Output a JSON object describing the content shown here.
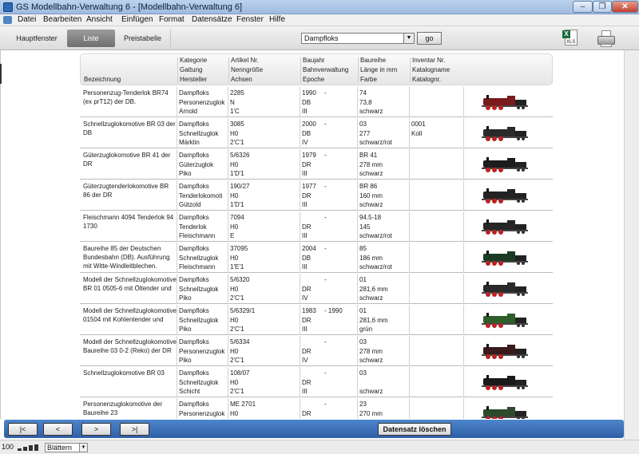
{
  "window": {
    "title": "GS Modellbahn-Verwaltung 6 - [Modellbahn-Verwaltung 6]",
    "minimize": "–",
    "maximize": "❐",
    "close": "✕"
  },
  "menu": [
    "Datei",
    "Bearbeiten",
    "Ansicht",
    "Einfügen",
    "Format",
    "Datensätze",
    "Fenster",
    "Hilfe"
  ],
  "toolbar": {
    "tabs": [
      "Hauptfenster",
      "Liste",
      "Preistabelle"
    ],
    "filter_value": "Dampfloks",
    "go_label": "go",
    "xls_label": "XLS"
  },
  "header": {
    "bezeichnung": "Bezeichnung",
    "col2": [
      "Kategorie",
      "Gattung",
      "Hersteller"
    ],
    "col3": [
      "Artikel Nr.",
      "Nenngröße",
      "Achsen"
    ],
    "col4": [
      "Baujahr",
      "Bahnverwaltung",
      "Epoche"
    ],
    "col5": [
      "Baureihe",
      "Länge in mm",
      "Farbe"
    ],
    "col6": [
      "Inventar Nr.",
      "Katalogname",
      "Katalognr."
    ]
  },
  "rows": [
    {
      "desc": "Personenzug-Tenderlok BR74 (ex prT12) der DB.",
      "c2": [
        "Dampfloks",
        "Personenzuglok",
        "Arnold"
      ],
      "c3": [
        "2285",
        "N",
        "1'C"
      ],
      "c4": [
        "1990",
        "DB",
        "III"
      ],
      "dash": "-",
      "c5": [
        "74",
        "73,8",
        "schwarz"
      ],
      "c6": [
        "",
        "",
        ""
      ],
      "img_tone": "#7a1b1b"
    },
    {
      "desc": "Schnellzuglokomotive BR 03 der DB",
      "c2": [
        "Dampfloks",
        "Schnellzuglok",
        "Märklin"
      ],
      "c3": [
        "3085",
        "H0",
        "2'C'1"
      ],
      "c4": [
        "2000",
        "DB",
        "IV"
      ],
      "dash": "-",
      "c5": [
        "03",
        "277",
        "schwarz/rot"
      ],
      "c6": [
        "0001",
        "Koll",
        ""
      ],
      "img_tone": "#2a2a2a"
    },
    {
      "desc": "Güterzuglokomotive BR 41 der DR",
      "c2": [
        "Dampfloks",
        "Güterzuglok",
        "Piko"
      ],
      "c3": [
        "5/6326",
        "H0",
        "1'D'1"
      ],
      "c4": [
        "1979",
        "DR",
        "III"
      ],
      "dash": "-",
      "c5": [
        "BR 41",
        "278 mm",
        "schwarz"
      ],
      "c6": [
        "",
        "",
        ""
      ],
      "img_tone": "#1c1c1c"
    },
    {
      "desc": "Güterzugtenderlokomotive BR 86 der DR",
      "c2": [
        "Dampfloks",
        "Tenderlokomoti",
        "Gützold"
      ],
      "c3": [
        "190/27",
        "H0",
        "1'D'1"
      ],
      "c4": [
        "1977",
        "DR",
        "III"
      ],
      "dash": "-",
      "c5": [
        "BR 86",
        "160 mm",
        "schwarz"
      ],
      "c6": [
        "",
        "",
        ""
      ],
      "img_tone": "#222222"
    },
    {
      "desc": "Fleischmann 4094 Tenderlok 94 1730",
      "c2": [
        "Dampfloks",
        "Tenderlok",
        "Fleischmann"
      ],
      "c3": [
        "7094",
        "H0",
        "E"
      ],
      "c4": [
        "",
        "DR",
        "III"
      ],
      "dash": "-",
      "c5": [
        "94.5-18",
        "145",
        "schwarz/rot"
      ],
      "c6": [
        "",
        "",
        ""
      ],
      "img_tone": "#262626"
    },
    {
      "desc": "Baureihe 85 der Deutschen Bundesbahn (DB). Ausführung mit Witte-Windleitblechen.",
      "c2": [
        "Dampfloks",
        "Schnellzuglok",
        "Fleischmann"
      ],
      "c3": [
        "37095",
        "H0",
        "1'E'1"
      ],
      "c4": [
        "2004",
        "DB",
        "III"
      ],
      "dash": "-",
      "c5": [
        "85",
        "186 mm",
        "schwarz/rot"
      ],
      "c6": [
        "",
        "",
        ""
      ],
      "img_tone": "#1d3a22"
    },
    {
      "desc": "Modell der Schnellzuglokomotive BR 01 0505-6 mit Öltender und",
      "c2": [
        "Dampfloks",
        "Schnellzuglok",
        "Piko"
      ],
      "c3": [
        "5/6320",
        "H0",
        "2'C'1"
      ],
      "c4": [
        "",
        "DR",
        "IV"
      ],
      "dash": "-",
      "c5": [
        "01",
        "281,6 mm",
        "schwarz"
      ],
      "c6": [
        "",
        "",
        ""
      ],
      "img_tone": "#2a2a2a"
    },
    {
      "desc": "Modell der Schnellzuglokomotive 01504 mit Kohlentender und",
      "c2": [
        "Dampfloks",
        "Schnellzuglok",
        "Piko"
      ],
      "c3": [
        "5/6329/1",
        "H0",
        "2'C'1"
      ],
      "c4": [
        "1983",
        "DR",
        "III"
      ],
      "dash": "- 1990",
      "c5": [
        "01",
        "281,6 mm",
        "grün"
      ],
      "c6": [
        "",
        "",
        ""
      ],
      "img_tone": "#2e5e2a"
    },
    {
      "desc": "Modell der Schnellzuglokomotive Baureihe 03 0-2 (Reko) der DR",
      "c2": [
        "Dampfloks",
        "Personenzuglok",
        "Piko"
      ],
      "c3": [
        "5/6334",
        "H0",
        "2'C'1"
      ],
      "c4": [
        "",
        "DR",
        "IV"
      ],
      "dash": "-",
      "c5": [
        "03",
        "278 mm",
        "schwarz"
      ],
      "c6": [
        "",
        "",
        ""
      ],
      "img_tone": "#3a1a1a"
    },
    {
      "desc": "Schnellzuglokomotive BR 03",
      "c2": [
        "Dampfloks",
        "Schnellzuglok",
        "Schicht"
      ],
      "c3": [
        "108/07",
        "H0",
        "2'C'1"
      ],
      "c4": [
        "",
        "DR",
        "III"
      ],
      "dash": "-",
      "c5": [
        "03",
        "",
        "schwarz"
      ],
      "c6": [
        "",
        "",
        ""
      ],
      "img_tone": "#1a1a1a"
    },
    {
      "desc": "Personenzuglokomotive der Baureihe 23",
      "c2": [
        "Dampfloks",
        "Personenzuglok",
        ""
      ],
      "c3": [
        "ME 2701",
        "H0",
        ""
      ],
      "c4": [
        "",
        "DR",
        ""
      ],
      "dash": "-",
      "c5": [
        "23",
        "270 mm",
        ""
      ],
      "c6": [
        "",
        "",
        ""
      ],
      "img_tone": "#2d4a2d"
    }
  ],
  "nav": {
    "first": "|<",
    "prev": "<",
    "next": ">",
    "last": ">|",
    "delete": "Datensatz löschen"
  },
  "status": {
    "zoom": "100",
    "mode": "Blättern"
  }
}
